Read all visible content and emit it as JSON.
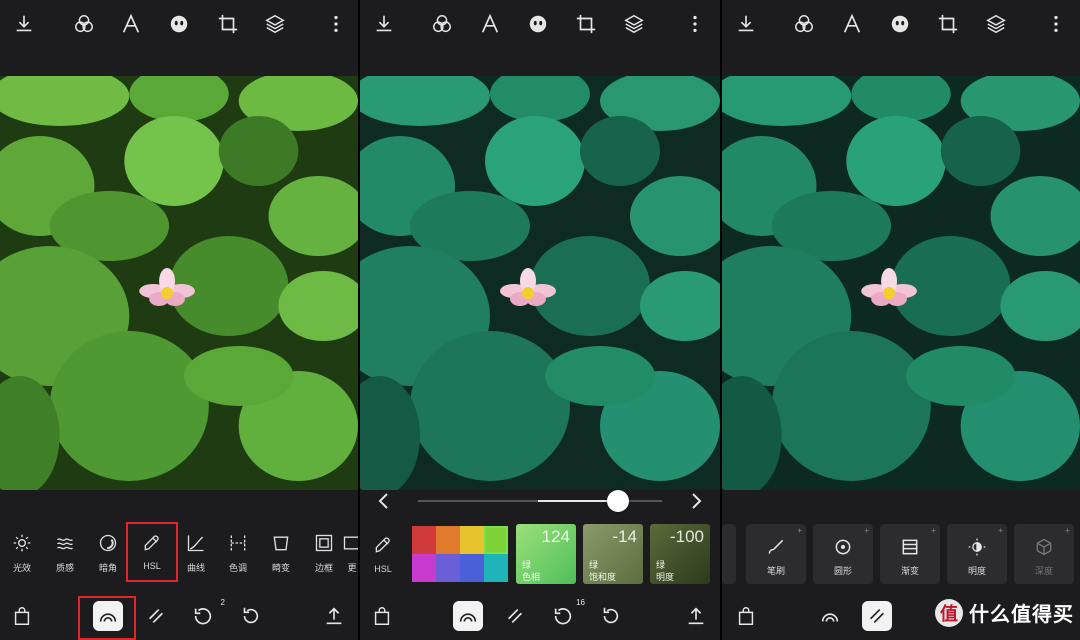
{
  "icons": {
    "top": [
      "download-icon",
      "filters-icon",
      "text-icon",
      "face-icon",
      "crop-icon",
      "layers-icon",
      "more-icon"
    ]
  },
  "panel1": {
    "tools": [
      {
        "name": "light",
        "label": "光效"
      },
      {
        "name": "texture",
        "label": "质感"
      },
      {
        "name": "vignette",
        "label": "暗角"
      },
      {
        "name": "hsl",
        "label": "HSL"
      },
      {
        "name": "curves",
        "label": "曲线"
      },
      {
        "name": "tone",
        "label": "色调"
      },
      {
        "name": "distort",
        "label": "畸变"
      },
      {
        "name": "border",
        "label": "边框"
      },
      {
        "name": "more",
        "label": "更"
      }
    ],
    "redo_count": "2"
  },
  "panel2": {
    "slider_value": 0.82,
    "hsl_label": "HSL",
    "swatch_colors": [
      "#d13a3a",
      "#e07b2e",
      "#e6c22c",
      "#7fd236",
      "#c93bcf",
      "#6a5fd6",
      "#4a5fd8",
      "#1fb4b8"
    ],
    "cards": [
      {
        "value": "124",
        "line1": "绿",
        "line2": "色相"
      },
      {
        "value": "-14",
        "line1": "绿",
        "line2": "饱和度"
      },
      {
        "value": "-100",
        "line1": "绿",
        "line2": "明度"
      }
    ],
    "redo_count": "16"
  },
  "panel3": {
    "mask_tools": [
      {
        "name": "brush",
        "label": "笔刷"
      },
      {
        "name": "radial",
        "label": "圆形"
      },
      {
        "name": "gradient",
        "label": "渐变"
      },
      {
        "name": "luminance",
        "label": "明度"
      },
      {
        "name": "depth",
        "label": "深度"
      }
    ],
    "watermark_logo": "值",
    "watermark_text": "什么值得买"
  }
}
